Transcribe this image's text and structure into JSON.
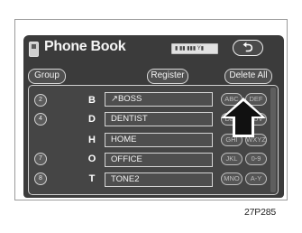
{
  "header": {
    "title": "Phone Book",
    "status_text": "▮ ▮▮ ▮▮▮ Y▮",
    "back_symbol": "⮌"
  },
  "controls": {
    "group_label": "Group",
    "register_label": "Register",
    "delete_all_label": "Delete All"
  },
  "list": {
    "rows": [
      {
        "circle": "2",
        "letter": "B",
        "name": "↗BOSS",
        "tabs": [
          "ABC",
          "DEF"
        ]
      },
      {
        "circle": "4",
        "letter": "D",
        "name": "DENTIST",
        "tabs": [
          "DEF",
          "TUV"
        ]
      },
      {
        "circle": "",
        "letter": "H",
        "name": "HOME",
        "tabs": [
          "GHI",
          "WXYZ"
        ]
      },
      {
        "circle": "7",
        "letter": "O",
        "name": "OFFICE",
        "tabs": [
          "JKL",
          "0-9"
        ]
      },
      {
        "circle": "8",
        "letter": "T",
        "name": "TONE2",
        "tabs": [
          "MNO",
          "A-Y"
        ]
      }
    ]
  },
  "caption": "27P285"
}
